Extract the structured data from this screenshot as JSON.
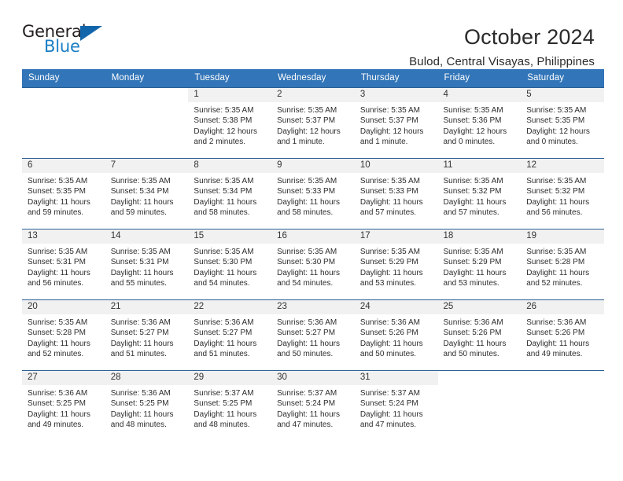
{
  "brand": {
    "name_part1": "General",
    "name_part2": "Blue",
    "triangle_icon": "triangle-icon",
    "accent_color": "#1a7ec4",
    "triangle_color": "#1166ab"
  },
  "header": {
    "title": "October 2024",
    "subtitle": "Bulod, Central Visayas, Philippines"
  },
  "calendar": {
    "header_bg": "#3275b8",
    "daynum_bg": "#f1f1f1",
    "weekday_headers": [
      "Sunday",
      "Monday",
      "Tuesday",
      "Wednesday",
      "Thursday",
      "Friday",
      "Saturday"
    ],
    "weeks": [
      [
        {
          "day": "",
          "sunrise": "",
          "sunset": "",
          "daylight": ""
        },
        {
          "day": "",
          "sunrise": "",
          "sunset": "",
          "daylight": ""
        },
        {
          "day": "1",
          "sunrise": "Sunrise: 5:35 AM",
          "sunset": "Sunset: 5:38 PM",
          "daylight": "Daylight: 12 hours and 2 minutes."
        },
        {
          "day": "2",
          "sunrise": "Sunrise: 5:35 AM",
          "sunset": "Sunset: 5:37 PM",
          "daylight": "Daylight: 12 hours and 1 minute."
        },
        {
          "day": "3",
          "sunrise": "Sunrise: 5:35 AM",
          "sunset": "Sunset: 5:37 PM",
          "daylight": "Daylight: 12 hours and 1 minute."
        },
        {
          "day": "4",
          "sunrise": "Sunrise: 5:35 AM",
          "sunset": "Sunset: 5:36 PM",
          "daylight": "Daylight: 12 hours and 0 minutes."
        },
        {
          "day": "5",
          "sunrise": "Sunrise: 5:35 AM",
          "sunset": "Sunset: 5:35 PM",
          "daylight": "Daylight: 12 hours and 0 minutes."
        }
      ],
      [
        {
          "day": "6",
          "sunrise": "Sunrise: 5:35 AM",
          "sunset": "Sunset: 5:35 PM",
          "daylight": "Daylight: 11 hours and 59 minutes."
        },
        {
          "day": "7",
          "sunrise": "Sunrise: 5:35 AM",
          "sunset": "Sunset: 5:34 PM",
          "daylight": "Daylight: 11 hours and 59 minutes."
        },
        {
          "day": "8",
          "sunrise": "Sunrise: 5:35 AM",
          "sunset": "Sunset: 5:34 PM",
          "daylight": "Daylight: 11 hours and 58 minutes."
        },
        {
          "day": "9",
          "sunrise": "Sunrise: 5:35 AM",
          "sunset": "Sunset: 5:33 PM",
          "daylight": "Daylight: 11 hours and 58 minutes."
        },
        {
          "day": "10",
          "sunrise": "Sunrise: 5:35 AM",
          "sunset": "Sunset: 5:33 PM",
          "daylight": "Daylight: 11 hours and 57 minutes."
        },
        {
          "day": "11",
          "sunrise": "Sunrise: 5:35 AM",
          "sunset": "Sunset: 5:32 PM",
          "daylight": "Daylight: 11 hours and 57 minutes."
        },
        {
          "day": "12",
          "sunrise": "Sunrise: 5:35 AM",
          "sunset": "Sunset: 5:32 PM",
          "daylight": "Daylight: 11 hours and 56 minutes."
        }
      ],
      [
        {
          "day": "13",
          "sunrise": "Sunrise: 5:35 AM",
          "sunset": "Sunset: 5:31 PM",
          "daylight": "Daylight: 11 hours and 56 minutes."
        },
        {
          "day": "14",
          "sunrise": "Sunrise: 5:35 AM",
          "sunset": "Sunset: 5:31 PM",
          "daylight": "Daylight: 11 hours and 55 minutes."
        },
        {
          "day": "15",
          "sunrise": "Sunrise: 5:35 AM",
          "sunset": "Sunset: 5:30 PM",
          "daylight": "Daylight: 11 hours and 54 minutes."
        },
        {
          "day": "16",
          "sunrise": "Sunrise: 5:35 AM",
          "sunset": "Sunset: 5:30 PM",
          "daylight": "Daylight: 11 hours and 54 minutes."
        },
        {
          "day": "17",
          "sunrise": "Sunrise: 5:35 AM",
          "sunset": "Sunset: 5:29 PM",
          "daylight": "Daylight: 11 hours and 53 minutes."
        },
        {
          "day": "18",
          "sunrise": "Sunrise: 5:35 AM",
          "sunset": "Sunset: 5:29 PM",
          "daylight": "Daylight: 11 hours and 53 minutes."
        },
        {
          "day": "19",
          "sunrise": "Sunrise: 5:35 AM",
          "sunset": "Sunset: 5:28 PM",
          "daylight": "Daylight: 11 hours and 52 minutes."
        }
      ],
      [
        {
          "day": "20",
          "sunrise": "Sunrise: 5:35 AM",
          "sunset": "Sunset: 5:28 PM",
          "daylight": "Daylight: 11 hours and 52 minutes."
        },
        {
          "day": "21",
          "sunrise": "Sunrise: 5:36 AM",
          "sunset": "Sunset: 5:27 PM",
          "daylight": "Daylight: 11 hours and 51 minutes."
        },
        {
          "day": "22",
          "sunrise": "Sunrise: 5:36 AM",
          "sunset": "Sunset: 5:27 PM",
          "daylight": "Daylight: 11 hours and 51 minutes."
        },
        {
          "day": "23",
          "sunrise": "Sunrise: 5:36 AM",
          "sunset": "Sunset: 5:27 PM",
          "daylight": "Daylight: 11 hours and 50 minutes."
        },
        {
          "day": "24",
          "sunrise": "Sunrise: 5:36 AM",
          "sunset": "Sunset: 5:26 PM",
          "daylight": "Daylight: 11 hours and 50 minutes."
        },
        {
          "day": "25",
          "sunrise": "Sunrise: 5:36 AM",
          "sunset": "Sunset: 5:26 PM",
          "daylight": "Daylight: 11 hours and 50 minutes."
        },
        {
          "day": "26",
          "sunrise": "Sunrise: 5:36 AM",
          "sunset": "Sunset: 5:26 PM",
          "daylight": "Daylight: 11 hours and 49 minutes."
        }
      ],
      [
        {
          "day": "27",
          "sunrise": "Sunrise: 5:36 AM",
          "sunset": "Sunset: 5:25 PM",
          "daylight": "Daylight: 11 hours and 49 minutes."
        },
        {
          "day": "28",
          "sunrise": "Sunrise: 5:36 AM",
          "sunset": "Sunset: 5:25 PM",
          "daylight": "Daylight: 11 hours and 48 minutes."
        },
        {
          "day": "29",
          "sunrise": "Sunrise: 5:37 AM",
          "sunset": "Sunset: 5:25 PM",
          "daylight": "Daylight: 11 hours and 48 minutes."
        },
        {
          "day": "30",
          "sunrise": "Sunrise: 5:37 AM",
          "sunset": "Sunset: 5:24 PM",
          "daylight": "Daylight: 11 hours and 47 minutes."
        },
        {
          "day": "31",
          "sunrise": "Sunrise: 5:37 AM",
          "sunset": "Sunset: 5:24 PM",
          "daylight": "Daylight: 11 hours and 47 minutes."
        },
        {
          "day": "",
          "sunrise": "",
          "sunset": "",
          "daylight": ""
        },
        {
          "day": "",
          "sunrise": "",
          "sunset": "",
          "daylight": ""
        }
      ]
    ]
  }
}
